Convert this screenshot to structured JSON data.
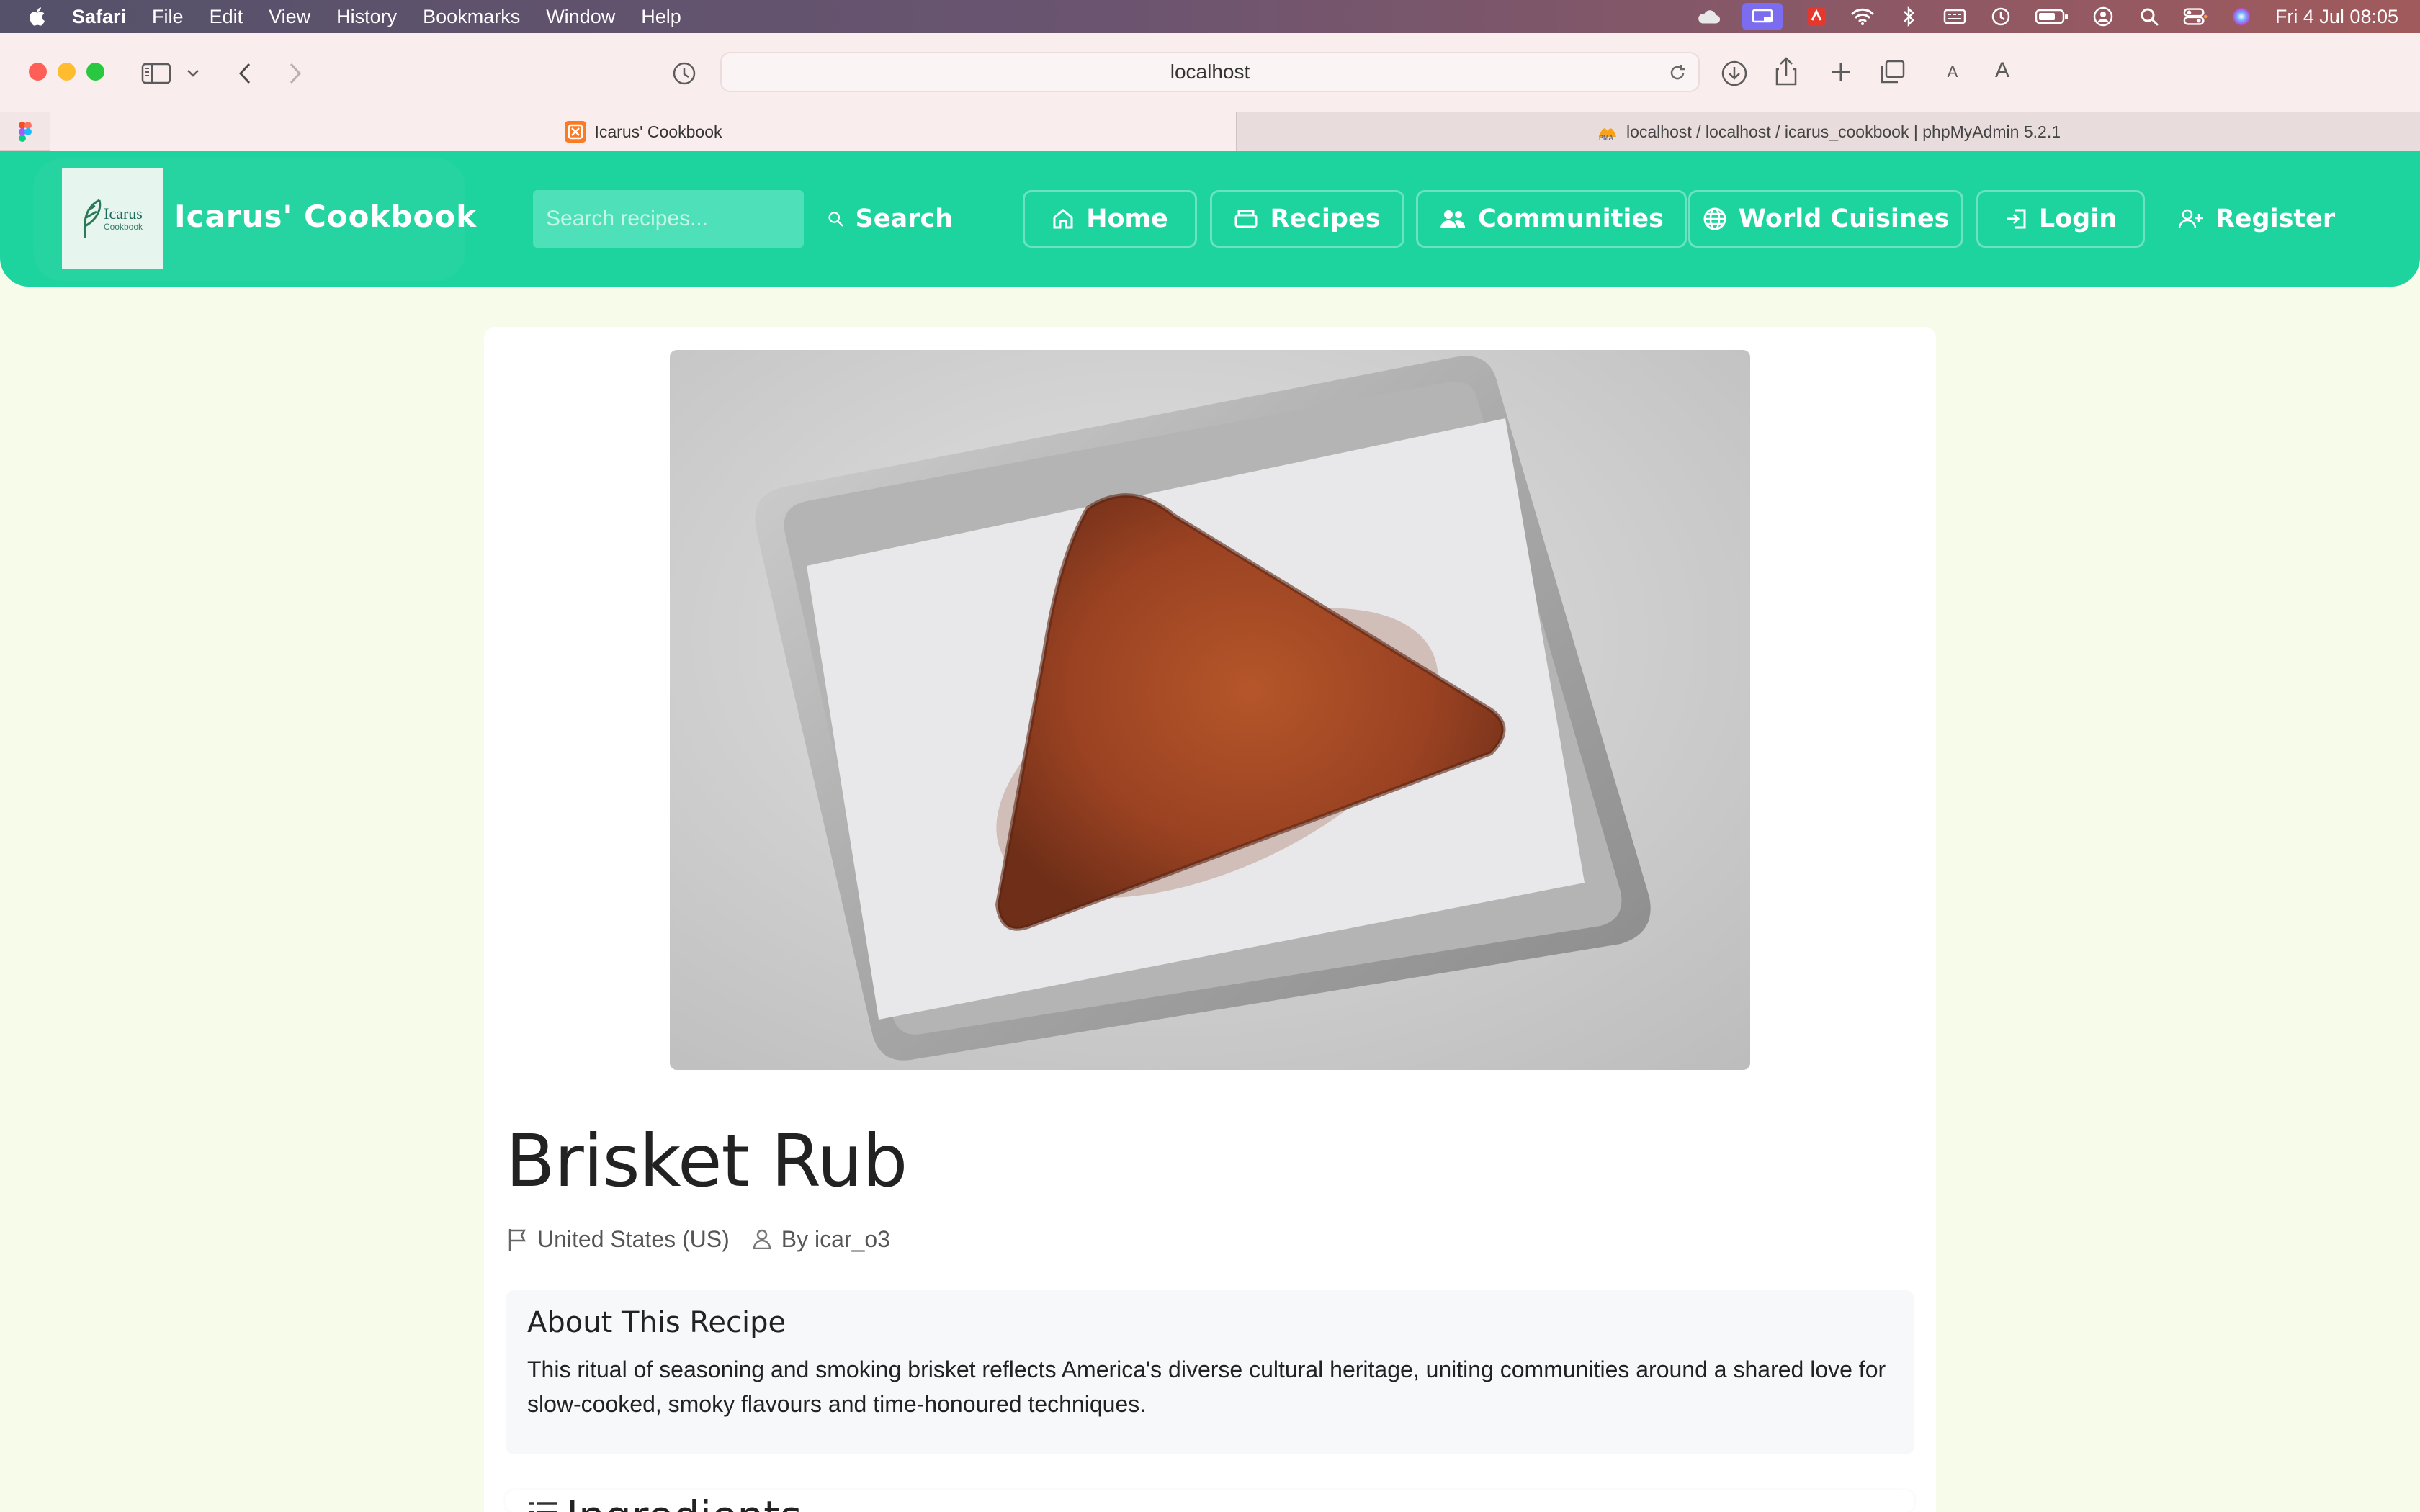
{
  "menubar": {
    "app_name": "Safari",
    "items": [
      "File",
      "Edit",
      "View",
      "History",
      "Bookmarks",
      "Window",
      "Help"
    ],
    "clock": "Fri 4 Jul  08:05"
  },
  "browser": {
    "address": "localhost",
    "tabs": [
      {
        "title": "Icarus' Cookbook",
        "active": true
      },
      {
        "title": "localhost / localhost / icarus_cookbook | phpMyAdmin 5.2.1",
        "active": false
      }
    ]
  },
  "site": {
    "logo_text": "Icarus",
    "logo_subtext": "Cookbook",
    "brand": "Icarus' Cookbook",
    "search_placeholder": "Search recipes...",
    "search_label": "Search",
    "nav": {
      "home": "Home",
      "recipes": "Recipes",
      "communities": "Communities",
      "world_cuisines": "World Cuisines",
      "login": "Login",
      "register": "Register"
    },
    "accent_color": "#1dd39e"
  },
  "recipe": {
    "title": "Brisket Rub",
    "country": "United States (US)",
    "author": "By icar_o3",
    "about_heading": "About This Recipe",
    "about_text": "This ritual of seasoning and smoking brisket reflects America's diverse cultural heritage, uniting communities around a shared love for slow-cooked, smoky flavours and time-honoured techniques.",
    "ingredients_heading": "Ingredients"
  }
}
